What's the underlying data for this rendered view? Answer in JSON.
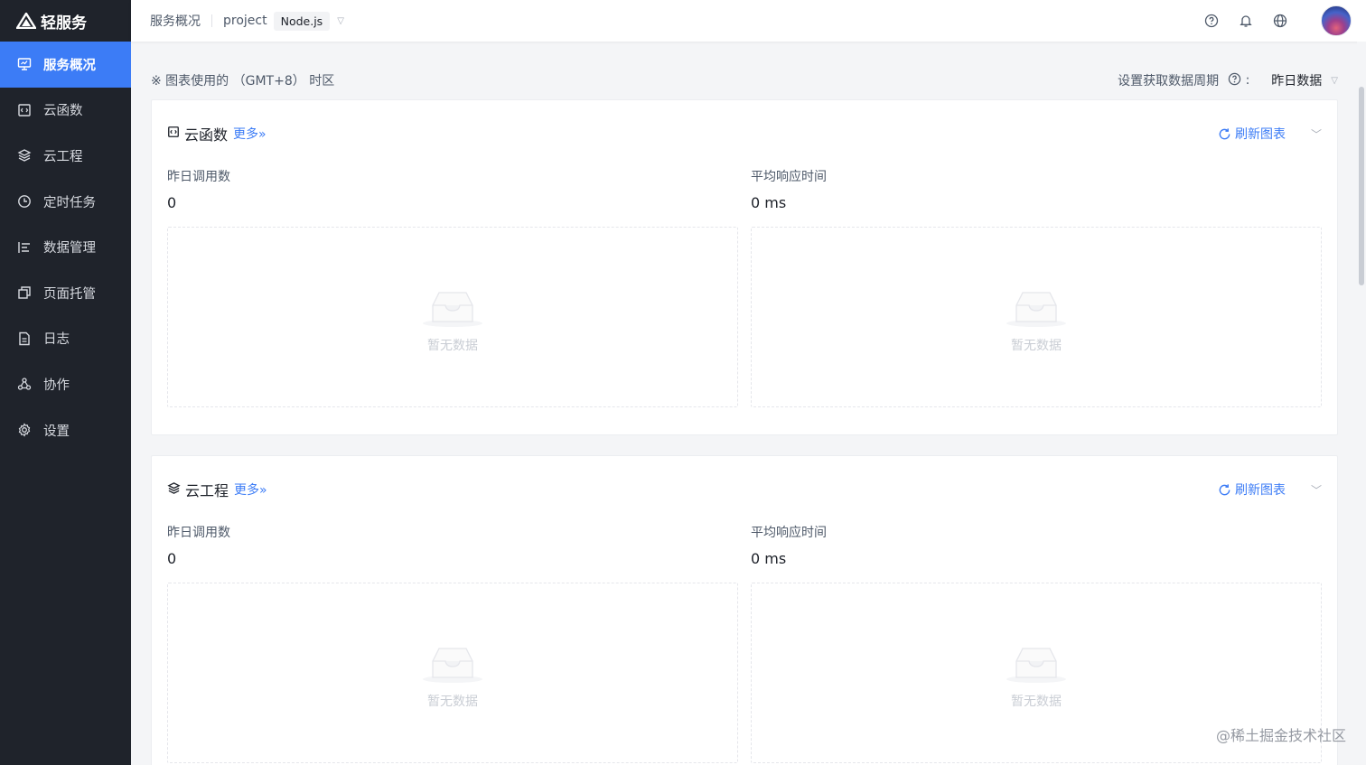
{
  "app": {
    "name": "轻服务"
  },
  "sidebar": {
    "items": [
      {
        "label": "服务概况",
        "icon": "monitor-icon",
        "active": true
      },
      {
        "label": "云函数",
        "icon": "function-icon"
      },
      {
        "label": "云工程",
        "icon": "layers-icon"
      },
      {
        "label": "定时任务",
        "icon": "clock-icon"
      },
      {
        "label": "数据管理",
        "icon": "data-icon"
      },
      {
        "label": "页面托管",
        "icon": "pages-icon"
      },
      {
        "label": "日志",
        "icon": "log-icon"
      },
      {
        "label": "协作",
        "icon": "collab-icon"
      },
      {
        "label": "设置",
        "icon": "gear-icon"
      }
    ]
  },
  "header": {
    "breadcrumb_home": "服务概况",
    "project": "project",
    "runtime": "Node.js",
    "icons": [
      "help-icon",
      "bell-icon",
      "globe-icon",
      "avatar"
    ]
  },
  "timezone": {
    "note": "※ 图表使用的 （GMT+8） 时区",
    "period_label": "设置获取数据周期",
    "period_value": "昨日数据"
  },
  "cards": [
    {
      "title": "云函数",
      "more": "更多»",
      "refresh": "刷新图表",
      "metrics": [
        {
          "label": "昨日调用数",
          "value": "0"
        },
        {
          "label": "平均响应时间",
          "value": "0 ms"
        }
      ],
      "empty": [
        "暂无数据",
        "暂无数据"
      ]
    },
    {
      "title": "云工程",
      "more": "更多»",
      "refresh": "刷新图表",
      "metrics": [
        {
          "label": "昨日调用数",
          "value": "0"
        },
        {
          "label": "平均响应时间",
          "value": "0 ms"
        }
      ],
      "empty": [
        "暂无数据",
        "暂无数据"
      ]
    }
  ],
  "watermark": "@稀土掘金技术社区",
  "colors": {
    "accent": "#3c7cf6",
    "sidebar_bg": "#1f232b",
    "active_bg": "#3c7cf6"
  }
}
